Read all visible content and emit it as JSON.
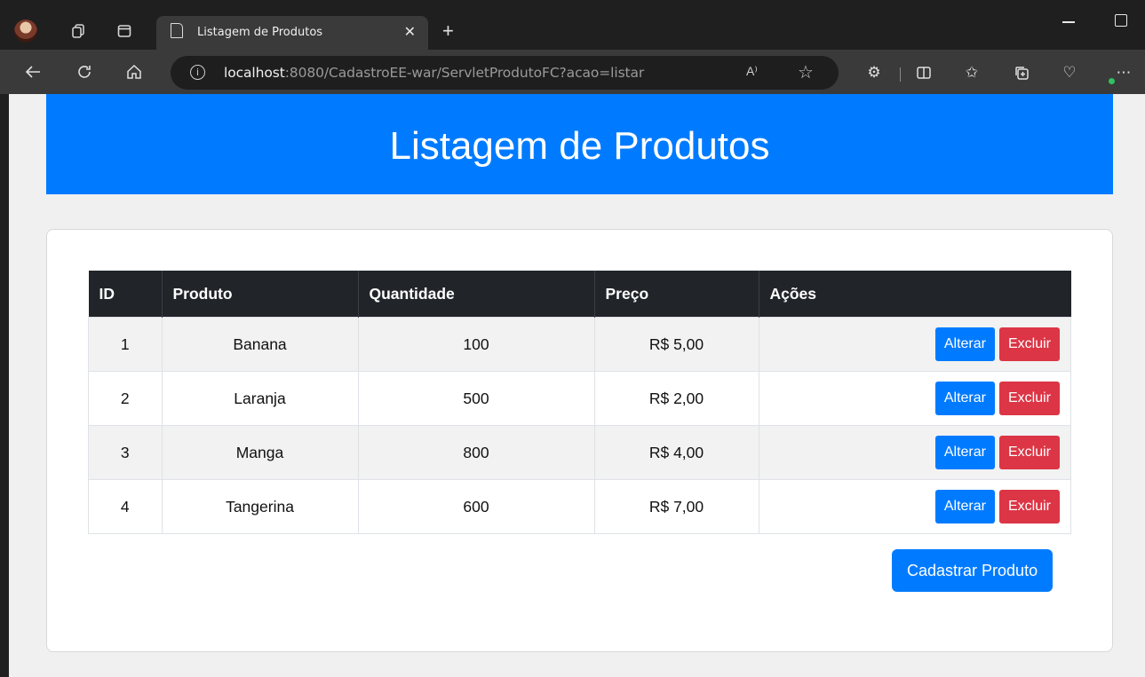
{
  "browser": {
    "tab_title": "Listagem de Produtos",
    "url_host": "localhost",
    "url_rest": ":8080/CadastroEE-war/ServletProdutoFC?acao=listar",
    "read_aloud": "A⁾"
  },
  "page": {
    "title": "Listagem de Produtos"
  },
  "table": {
    "headers": [
      "ID",
      "Produto",
      "Quantidade",
      "Preço",
      "Ações"
    ],
    "rows": [
      {
        "id": "1",
        "produto": "Banana",
        "quantidade": "100",
        "preco": "R$ 5,00"
      },
      {
        "id": "2",
        "produto": "Laranja",
        "quantidade": "500",
        "preco": "R$ 2,00"
      },
      {
        "id": "3",
        "produto": "Manga",
        "quantidade": "800",
        "preco": "R$ 4,00"
      },
      {
        "id": "4",
        "produto": "Tangerina",
        "quantidade": "600",
        "preco": "R$ 7,00"
      }
    ],
    "alter_label": "Alterar",
    "delete_label": "Excluir"
  },
  "actions": {
    "cadastrar_label": "Cadastrar Produto"
  },
  "colors": {
    "primary": "#007bff",
    "danger": "#dc3545",
    "table_header": "#212529"
  }
}
